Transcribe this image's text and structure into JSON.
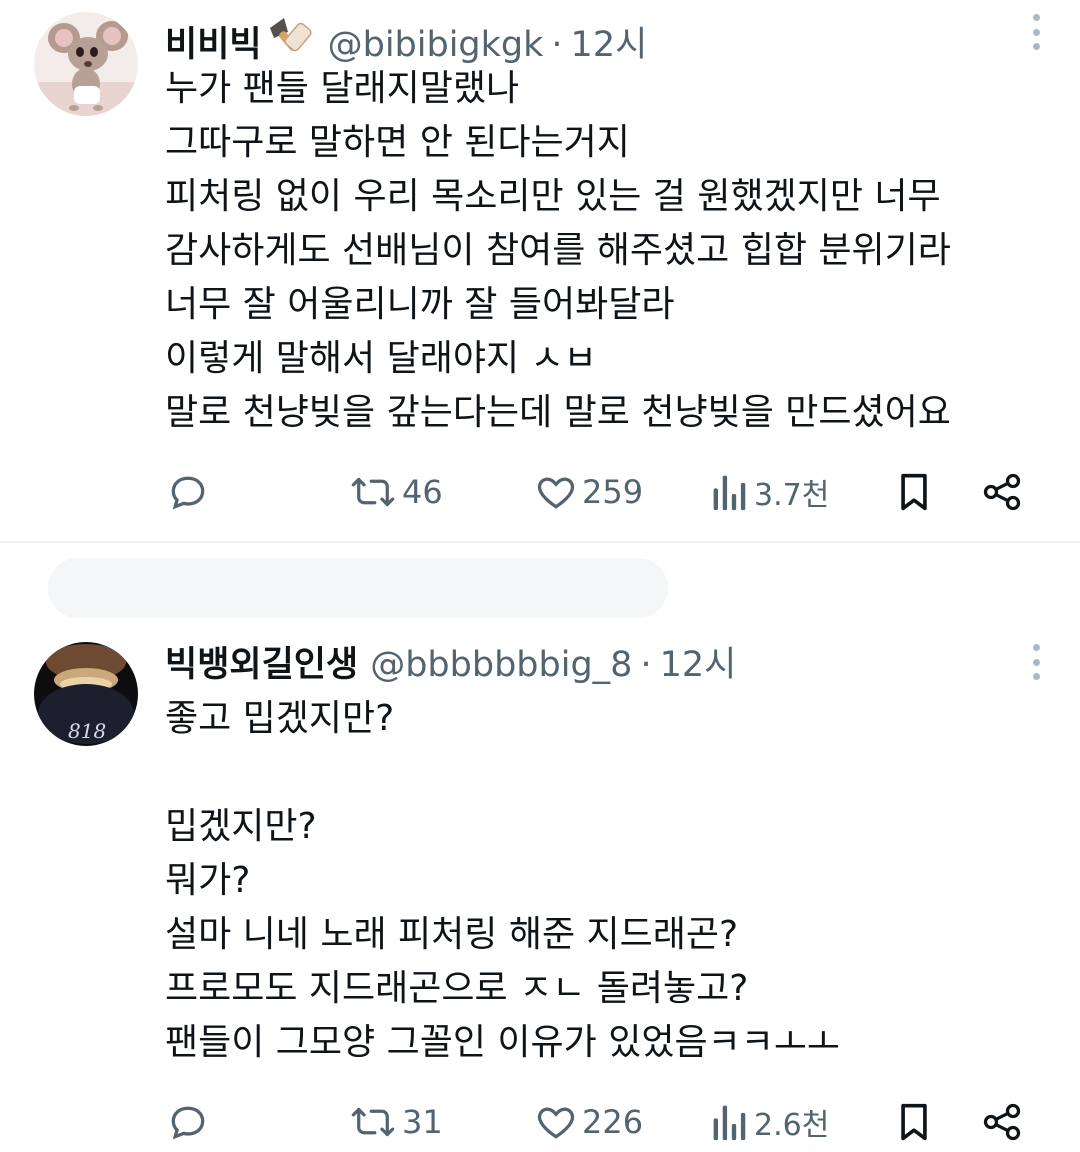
{
  "tweets": [
    {
      "name": "비비빅",
      "handle": "@bibibigkgk",
      "dot": "·",
      "time": "12시",
      "lines": [
        "누가 팬들 달래지말랬나",
        "그따구로 말하면 안 된다는거지",
        "피처링 없이 우리 목소리만 있는 걸 원했겠지만 너무",
        "감사하게도 선배님이 참여를 해주셨고 힙합 분위기라",
        "너무 잘 어울리니까 잘 들어봐달라",
        "이렇게 말해서 달래야지 ㅅㅂ",
        "말로 천냥빚을 갚는다는데 말로 천냥빚을 만드셨어요"
      ],
      "actions": {
        "reply_icon": "reply-icon",
        "retweet_icon": "retweet-icon",
        "retweets": "46",
        "like_icon": "heart-icon",
        "likes": "259",
        "views_icon": "views-icon",
        "views": "3.7천",
        "bookmark_icon": "bookmark-icon",
        "share_icon": "share-icon"
      }
    },
    {
      "name": "빅뱅외길인생",
      "handle": "@bbbbbbbig_8",
      "dot": "·",
      "time": "12시",
      "avatar_text": "818",
      "lines": [
        "좋고 밉겠지만?",
        "",
        "밉겠지만?",
        "뭐가?",
        "설마 니네 노래 피처링 해준 지드래곤?",
        "프로모도 지드래곤으로 ㅈㄴ 돌려놓고?",
        "팬들이 그모양 그꼴인 이유가 있었음ㅋㅋㅗㅗ"
      ],
      "actions": {
        "reply_icon": "reply-icon",
        "retweet_icon": "retweet-icon",
        "retweets": "31",
        "like_icon": "heart-icon",
        "likes": "226",
        "views_icon": "views-icon",
        "views": "2.6천",
        "bookmark_icon": "bookmark-icon",
        "share_icon": "share-icon"
      }
    }
  ],
  "colors": {
    "text": "#0f1419",
    "secondary": "#536471",
    "divider": "#eff3f4"
  }
}
